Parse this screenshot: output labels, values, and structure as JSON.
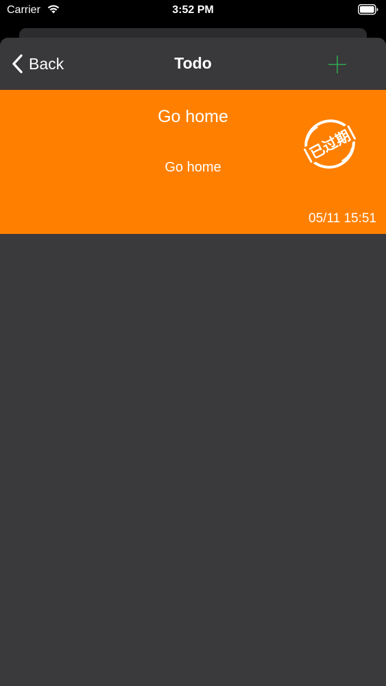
{
  "status_bar": {
    "carrier": "Carrier",
    "time": "3:52 PM",
    "icons": [
      "wifi-icon",
      "battery-icon"
    ]
  },
  "nav": {
    "back_label": "Back",
    "title": "Todo",
    "back_icon": "chevron-left-icon",
    "add_icon": "plus-icon",
    "add_color": "#2fa84f"
  },
  "todo": {
    "title": "Go home",
    "content": "Go home",
    "date": "05/11 15:51",
    "stamp": "已过期",
    "card_color": "#ff8000"
  },
  "colors": {
    "background": "#3a393c",
    "nav_background": "#39383b"
  }
}
